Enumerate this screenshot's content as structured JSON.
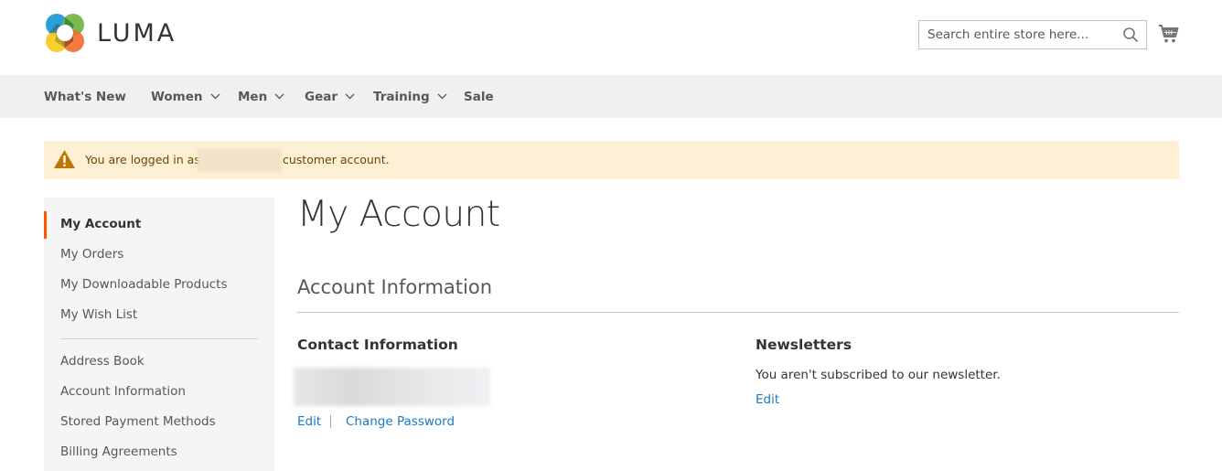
{
  "header": {
    "logo_text": "LUMA",
    "search": {
      "placeholder": "Search entire store here...",
      "value": ""
    },
    "icons": {
      "search": "search-icon",
      "cart": "shopping-cart-icon"
    }
  },
  "nav": {
    "items": [
      {
        "label": "What's New",
        "has_dropdown": false
      },
      {
        "label": "Women",
        "has_dropdown": true
      },
      {
        "label": "Men",
        "has_dropdown": true
      },
      {
        "label": "Gear",
        "has_dropdown": true
      },
      {
        "label": "Training",
        "has_dropdown": true
      },
      {
        "label": "Sale",
        "has_dropdown": false
      }
    ]
  },
  "message": {
    "prefix": "You are logged in as",
    "suffix": "customer account.",
    "icon": "warning-icon",
    "background_color": "#fdf0d5",
    "text_color": "#6f4400"
  },
  "sidebar": {
    "active_color": "#ff5501",
    "items": [
      {
        "label": "My Account",
        "active": true
      },
      {
        "label": "My Orders",
        "active": false
      },
      {
        "label": "My Downloadable Products",
        "active": false
      },
      {
        "label": "My Wish List",
        "active": false
      },
      {
        "label": "Address Book",
        "active": false
      },
      {
        "label": "Account Information",
        "active": false
      },
      {
        "label": "Stored Payment Methods",
        "active": false
      },
      {
        "label": "Billing Agreements",
        "active": false
      }
    ]
  },
  "main": {
    "page_title": "My Account",
    "block_title": "Account Information",
    "contact": {
      "title": "Contact Information",
      "edit_label": "Edit",
      "change_password_label": "Change Password"
    },
    "newsletters": {
      "title": "Newsletters",
      "text": "You aren't subscribed to our newsletter.",
      "edit_label": "Edit"
    },
    "link_color": "#1979c3"
  }
}
